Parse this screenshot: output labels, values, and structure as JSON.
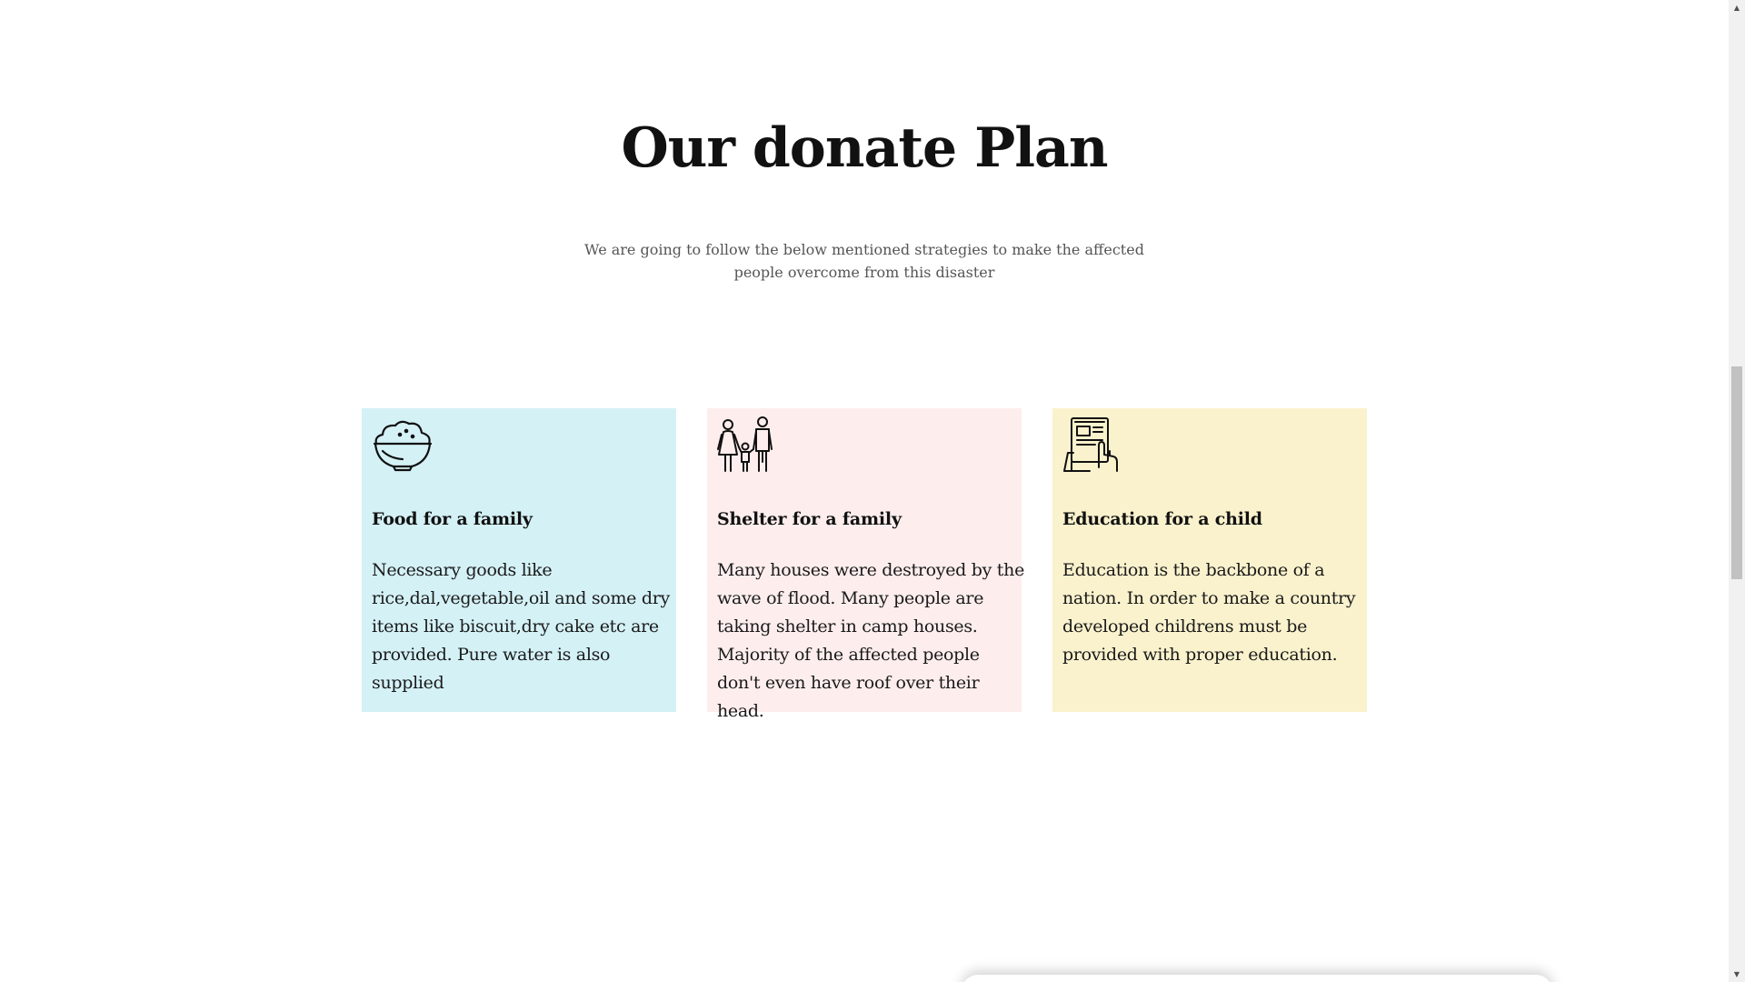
{
  "section": {
    "title": "Our donate Plan",
    "subtitle": "We are going to follow the below mentioned strategies to make the affected people overcome from this disaster"
  },
  "cards": [
    {
      "icon": "rice-bowl-icon",
      "title": "Food for a family",
      "text": "Necessary goods like rice,dal,vegetable,oil and some dry items like biscuit,dry cake etc are provided. Pure water is also supplied",
      "background": "#d4f1f6"
    },
    {
      "icon": "family-icon",
      "title": "Shelter for a family",
      "text": "Many houses were destroyed by the wave of flood. Many people are taking shelter in camp houses. Majority of the affected people don't even have roof over their head.",
      "background": "#fdeeed"
    },
    {
      "icon": "tablet-touch-icon",
      "title": "Education for a child",
      "text": "Education is the backbone of a nation. In order to make a country developed childrens must be provided with proper education.",
      "background": "#faf2cd"
    }
  ],
  "scrollbar": {
    "up_glyph": "▲",
    "down_glyph": "▼",
    "position_fraction": 0.42
  }
}
